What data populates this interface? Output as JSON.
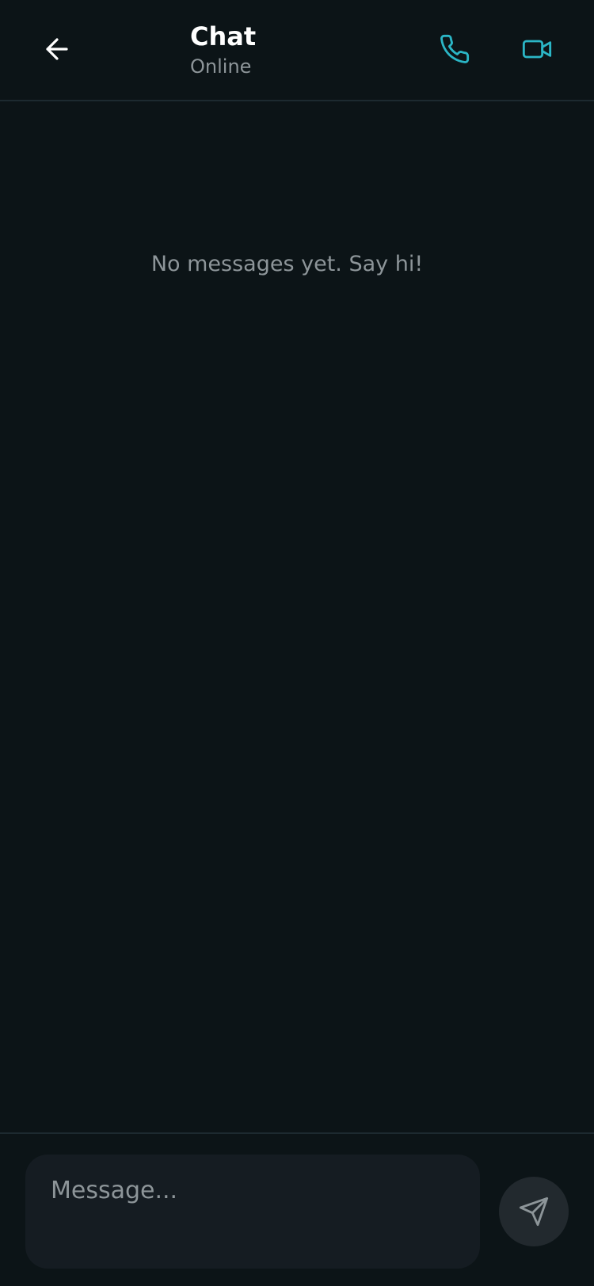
{
  "header": {
    "title": "Chat",
    "status": "Online",
    "back_icon": "arrow-left-icon",
    "call_icon": "phone-icon",
    "video_icon": "video-camera-icon",
    "accent_color": "#2bb6c6"
  },
  "messages": {
    "empty_text": "No messages yet. Say hi!"
  },
  "composer": {
    "placeholder": "Message...",
    "value": "",
    "send_icon": "send-icon"
  },
  "colors": {
    "background": "#0c1417",
    "input_background": "#151c22",
    "send_button_background": "#22292e",
    "muted_text": "#8d9599"
  }
}
